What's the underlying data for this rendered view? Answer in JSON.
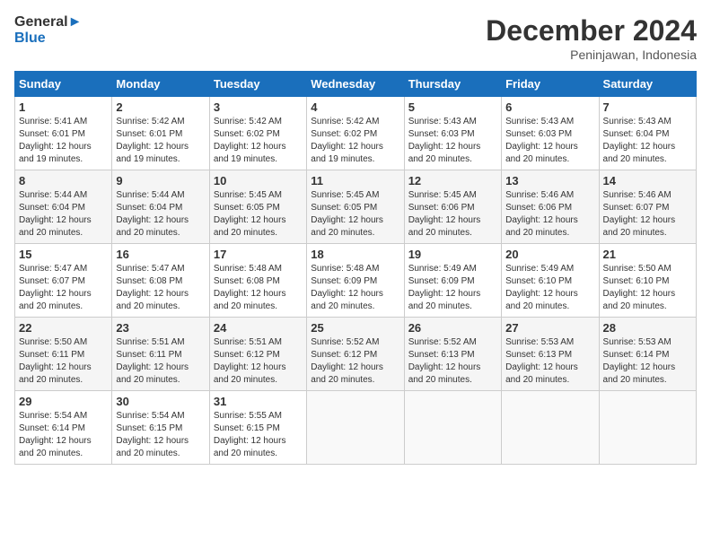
{
  "header": {
    "logo_text_general": "General",
    "logo_text_blue": "Blue",
    "month": "December 2024",
    "location": "Peninjawan, Indonesia"
  },
  "columns": [
    "Sunday",
    "Monday",
    "Tuesday",
    "Wednesday",
    "Thursday",
    "Friday",
    "Saturday"
  ],
  "weeks": [
    [
      {
        "day": "1",
        "sunrise": "5:41 AM",
        "sunset": "6:01 PM",
        "daylight": "12 hours and 19 minutes."
      },
      {
        "day": "2",
        "sunrise": "5:42 AM",
        "sunset": "6:01 PM",
        "daylight": "12 hours and 19 minutes."
      },
      {
        "day": "3",
        "sunrise": "5:42 AM",
        "sunset": "6:02 PM",
        "daylight": "12 hours and 19 minutes."
      },
      {
        "day": "4",
        "sunrise": "5:42 AM",
        "sunset": "6:02 PM",
        "daylight": "12 hours and 19 minutes."
      },
      {
        "day": "5",
        "sunrise": "5:43 AM",
        "sunset": "6:03 PM",
        "daylight": "12 hours and 20 minutes."
      },
      {
        "day": "6",
        "sunrise": "5:43 AM",
        "sunset": "6:03 PM",
        "daylight": "12 hours and 20 minutes."
      },
      {
        "day": "7",
        "sunrise": "5:43 AM",
        "sunset": "6:04 PM",
        "daylight": "12 hours and 20 minutes."
      }
    ],
    [
      {
        "day": "8",
        "sunrise": "5:44 AM",
        "sunset": "6:04 PM",
        "daylight": "12 hours and 20 minutes."
      },
      {
        "day": "9",
        "sunrise": "5:44 AM",
        "sunset": "6:04 PM",
        "daylight": "12 hours and 20 minutes."
      },
      {
        "day": "10",
        "sunrise": "5:45 AM",
        "sunset": "6:05 PM",
        "daylight": "12 hours and 20 minutes."
      },
      {
        "day": "11",
        "sunrise": "5:45 AM",
        "sunset": "6:05 PM",
        "daylight": "12 hours and 20 minutes."
      },
      {
        "day": "12",
        "sunrise": "5:45 AM",
        "sunset": "6:06 PM",
        "daylight": "12 hours and 20 minutes."
      },
      {
        "day": "13",
        "sunrise": "5:46 AM",
        "sunset": "6:06 PM",
        "daylight": "12 hours and 20 minutes."
      },
      {
        "day": "14",
        "sunrise": "5:46 AM",
        "sunset": "6:07 PM",
        "daylight": "12 hours and 20 minutes."
      }
    ],
    [
      {
        "day": "15",
        "sunrise": "5:47 AM",
        "sunset": "6:07 PM",
        "daylight": "12 hours and 20 minutes."
      },
      {
        "day": "16",
        "sunrise": "5:47 AM",
        "sunset": "6:08 PM",
        "daylight": "12 hours and 20 minutes."
      },
      {
        "day": "17",
        "sunrise": "5:48 AM",
        "sunset": "6:08 PM",
        "daylight": "12 hours and 20 minutes."
      },
      {
        "day": "18",
        "sunrise": "5:48 AM",
        "sunset": "6:09 PM",
        "daylight": "12 hours and 20 minutes."
      },
      {
        "day": "19",
        "sunrise": "5:49 AM",
        "sunset": "6:09 PM",
        "daylight": "12 hours and 20 minutes."
      },
      {
        "day": "20",
        "sunrise": "5:49 AM",
        "sunset": "6:10 PM",
        "daylight": "12 hours and 20 minutes."
      },
      {
        "day": "21",
        "sunrise": "5:50 AM",
        "sunset": "6:10 PM",
        "daylight": "12 hours and 20 minutes."
      }
    ],
    [
      {
        "day": "22",
        "sunrise": "5:50 AM",
        "sunset": "6:11 PM",
        "daylight": "12 hours and 20 minutes."
      },
      {
        "day": "23",
        "sunrise": "5:51 AM",
        "sunset": "6:11 PM",
        "daylight": "12 hours and 20 minutes."
      },
      {
        "day": "24",
        "sunrise": "5:51 AM",
        "sunset": "6:12 PM",
        "daylight": "12 hours and 20 minutes."
      },
      {
        "day": "25",
        "sunrise": "5:52 AM",
        "sunset": "6:12 PM",
        "daylight": "12 hours and 20 minutes."
      },
      {
        "day": "26",
        "sunrise": "5:52 AM",
        "sunset": "6:13 PM",
        "daylight": "12 hours and 20 minutes."
      },
      {
        "day": "27",
        "sunrise": "5:53 AM",
        "sunset": "6:13 PM",
        "daylight": "12 hours and 20 minutes."
      },
      {
        "day": "28",
        "sunrise": "5:53 AM",
        "sunset": "6:14 PM",
        "daylight": "12 hours and 20 minutes."
      }
    ],
    [
      {
        "day": "29",
        "sunrise": "5:54 AM",
        "sunset": "6:14 PM",
        "daylight": "12 hours and 20 minutes."
      },
      {
        "day": "30",
        "sunrise": "5:54 AM",
        "sunset": "6:15 PM",
        "daylight": "12 hours and 20 minutes."
      },
      {
        "day": "31",
        "sunrise": "5:55 AM",
        "sunset": "6:15 PM",
        "daylight": "12 hours and 20 minutes."
      },
      null,
      null,
      null,
      null
    ]
  ],
  "labels": {
    "sunrise": "Sunrise:",
    "sunset": "Sunset:",
    "daylight": "Daylight:"
  }
}
